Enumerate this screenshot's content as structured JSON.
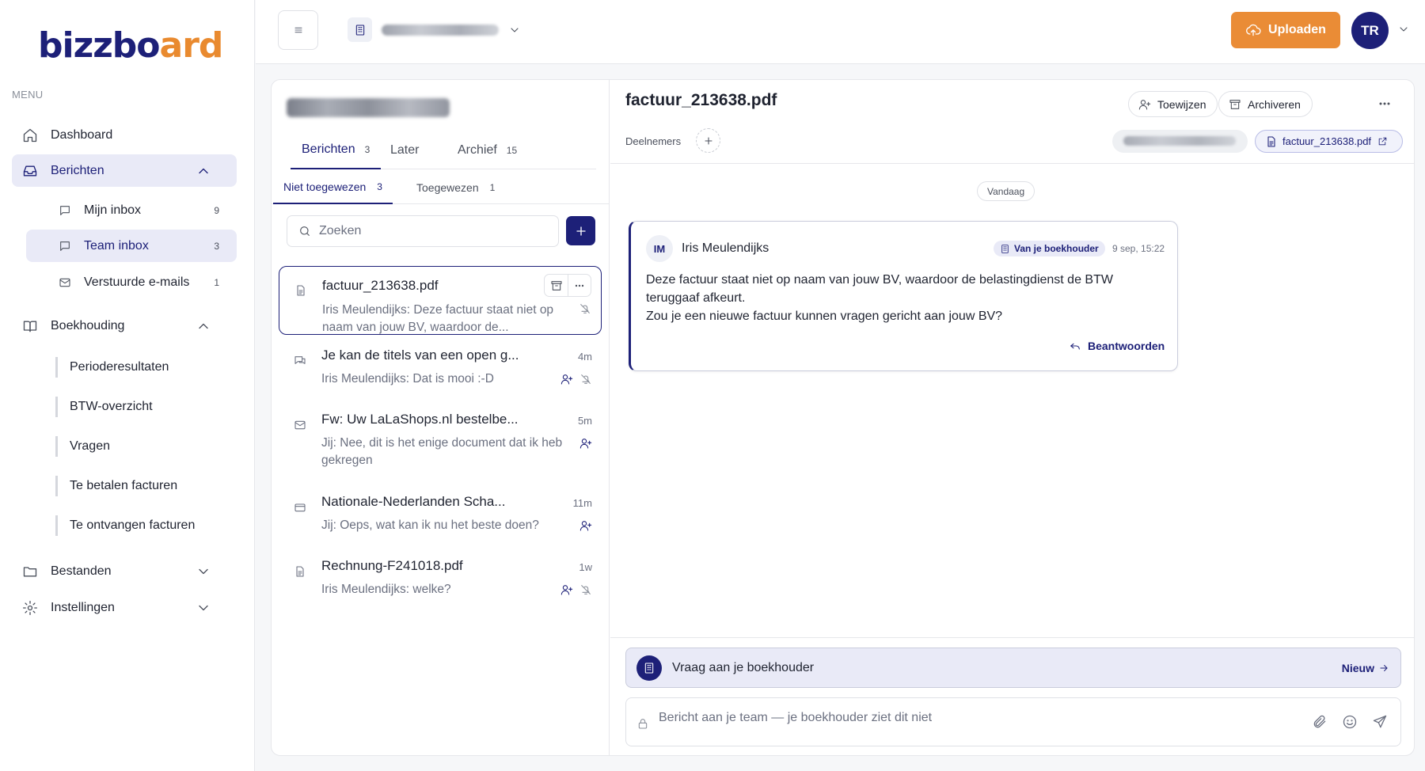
{
  "brand": {
    "logo_main": "bizzbo",
    "logo_accent": "ard"
  },
  "sidebar": {
    "menu_label": "MENU",
    "items": {
      "dashboard": "Dashboard",
      "berichten": "Berichten",
      "mijn_inbox": {
        "label": "Mijn inbox",
        "count": "9"
      },
      "team_inbox": {
        "label": "Team inbox",
        "count": "3"
      },
      "verstuurde": {
        "label": "Verstuurde e-mails",
        "count": "1"
      },
      "boekhouding": "Boekhouding",
      "perioderesultaten": "Perioderesultaten",
      "btw": "BTW-overzicht",
      "vragen": "Vragen",
      "te_betalen": "Te betalen facturen",
      "te_ontvangen": "Te ontvangen facturen",
      "bestanden": "Bestanden",
      "instellingen": "Instellingen"
    }
  },
  "topbar": {
    "upload_label": "Uploaden",
    "avatar_initials": "TR"
  },
  "list": {
    "tabs": [
      {
        "label": "Berichten",
        "count": "3"
      },
      {
        "label": "Later",
        "count": ""
      },
      {
        "label": "Archief",
        "count": "15"
      }
    ],
    "subtabs": [
      {
        "label": "Niet toegewezen",
        "count": "3"
      },
      {
        "label": "Toegewezen",
        "count": "1"
      }
    ],
    "search_placeholder": "Zoeken",
    "conversations": [
      {
        "title": "factuur_213638.pdf",
        "preview": "Iris Meulendijks: Deze factuur staat niet op naam van jouw BV, waardoor de...",
        "time": "",
        "type_icon": "document-icon"
      },
      {
        "title": "Je kan de titels van een open g...",
        "preview": "Iris Meulendijks: Dat is mooi :-D",
        "time": "4m",
        "type_icon": "chat-icon"
      },
      {
        "title": "Fw: Uw LaLaShops.nl bestelbe...",
        "preview": "Jij: Nee, dit is het enige document dat ik heb gekregen",
        "time": "5m",
        "type_icon": "mail-icon"
      },
      {
        "title": "Nationale-Nederlanden Scha...",
        "preview": "Jij: Oeps, wat kan ik nu het beste doen?",
        "time": "11m",
        "type_icon": "card-icon"
      },
      {
        "title": "Rechnung-F241018.pdf",
        "preview": "Iris Meulendijks: welke?",
        "time": "1w",
        "type_icon": "document-icon"
      }
    ]
  },
  "detail": {
    "title": "factuur_213638.pdf",
    "assign_label": "Toewijzen",
    "archive_label": "Archiveren",
    "participants_label": "Deelnemers",
    "file_chip": "factuur_213638.pdf",
    "day_label": "Vandaag",
    "message": {
      "initials": "IM",
      "author": "Iris Meulendijks",
      "badge": "Van je boekhouder",
      "time": "9 sep, 15:22",
      "line1": "Deze factuur staat niet op naam van jouw BV, waardoor de belastingdienst de BTW teruggaaf afkeurt.",
      "line2": "Zou je een nieuwe factuur kunnen vragen gericht aan jouw BV?",
      "reply_label": "Beantwoorden"
    },
    "ask_bar": {
      "text": "Vraag aan je boekhouder",
      "new_label": "Nieuw"
    },
    "composer_placeholder": "Bericht aan je team — je boekhouder ziet dit niet"
  },
  "colors": {
    "brand": "#1d2078",
    "accent": "#ea8c36"
  }
}
